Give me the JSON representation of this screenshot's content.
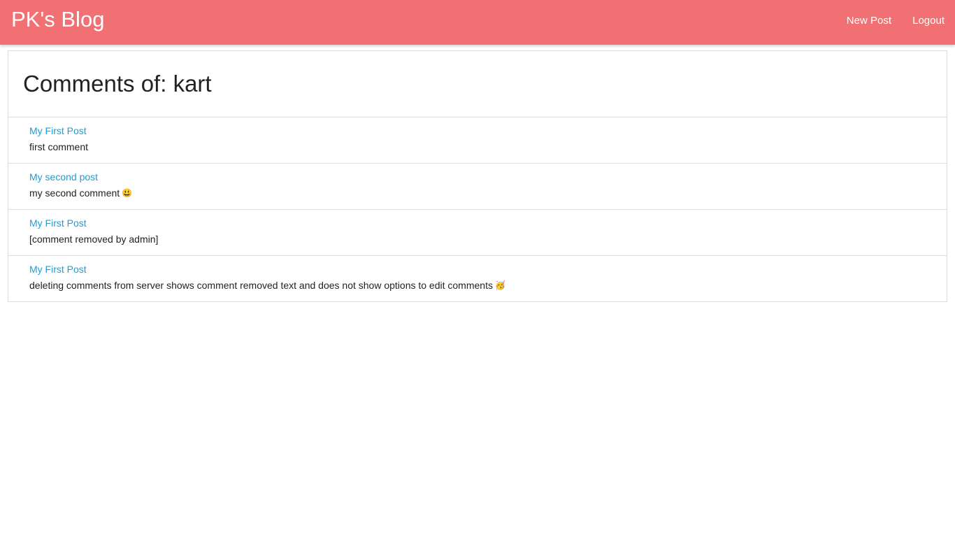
{
  "navbar": {
    "brand": "PK's Blog",
    "links": [
      {
        "label": "New Post"
      },
      {
        "label": "Logout"
      }
    ],
    "background_color": "#f07074"
  },
  "page": {
    "title": "Comments of: kart"
  },
  "comments": [
    {
      "post_title": "My First Post",
      "text": "first comment",
      "emoji": ""
    },
    {
      "post_title": "My second post",
      "text": "my second comment",
      "emoji": "😃"
    },
    {
      "post_title": "My First Post",
      "text": "[comment removed by admin]",
      "emoji": ""
    },
    {
      "post_title": "My First Post",
      "text": "deleting comments from server shows comment removed text and does not show options to edit comments",
      "emoji": "🥳"
    }
  ],
  "colors": {
    "link": "#1a9ed8",
    "border": "#dddddd"
  }
}
